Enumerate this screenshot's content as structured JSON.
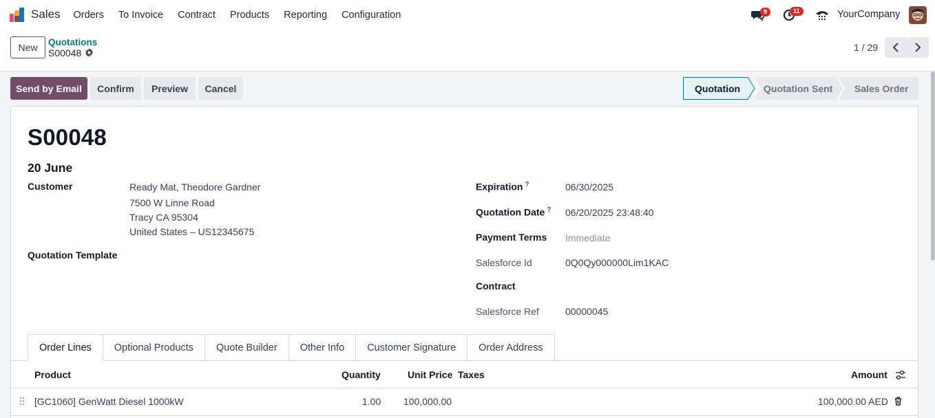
{
  "nav": {
    "app_name": "Sales",
    "menu": [
      "Orders",
      "To Invoice",
      "Contract",
      "Products",
      "Reporting",
      "Configuration"
    ],
    "messages_count": "9",
    "activities_count": "11",
    "company": "YourCompany"
  },
  "control": {
    "new_label": "New",
    "breadcrumb_parent": "Quotations",
    "breadcrumb_current": "S00048",
    "pager": "1 / 29"
  },
  "actions": {
    "send_email": "Send by Email",
    "confirm": "Confirm",
    "preview": "Preview",
    "cancel": "Cancel"
  },
  "stages": [
    {
      "label": "Quotation",
      "active": true
    },
    {
      "label": "Quotation Sent",
      "active": false
    },
    {
      "label": "Sales Order",
      "active": false
    }
  ],
  "form": {
    "title": "S00048",
    "subtitle": "20 June",
    "customer_label": "Customer",
    "customer_lines": [
      "Ready Mat, Theodore Gardner",
      "7500 W Linne Road",
      "Tracy CA 95304",
      "United States – US12345675"
    ],
    "template_label": "Quotation Template",
    "expiration_label": "Expiration",
    "expiration_value": "06/30/2025",
    "quotation_date_label": "Quotation Date",
    "quotation_date_value": "06/20/2025 23:48:40",
    "payment_terms_label": "Payment Terms",
    "payment_terms_value": "Immediate",
    "salesforce_id_label": "Salesforce Id",
    "salesforce_id_value": "0Q0Qy000000Lim1KAC",
    "contract_label": "Contract",
    "salesforce_ref_label": "Salesforce Ref",
    "salesforce_ref_value": "00000045",
    "help_mark": "?"
  },
  "tabs": [
    "Order Lines",
    "Optional Products",
    "Quote Builder",
    "Other Info",
    "Customer Signature",
    "Order Address"
  ],
  "order_lines": {
    "headers": {
      "product": "Product",
      "quantity": "Quantity",
      "unit_price": "Unit Price",
      "taxes": "Taxes",
      "amount": "Amount"
    },
    "rows": [
      {
        "product": "[GC1060] GenWatt Diesel 1000kW",
        "quantity": "1.00",
        "unit_price": "100,000.00",
        "taxes": "",
        "amount": "100,000.00 AED"
      }
    ]
  },
  "colors": {
    "brand": "#714b67",
    "link": "#017e84",
    "badge": "#dc2626"
  }
}
